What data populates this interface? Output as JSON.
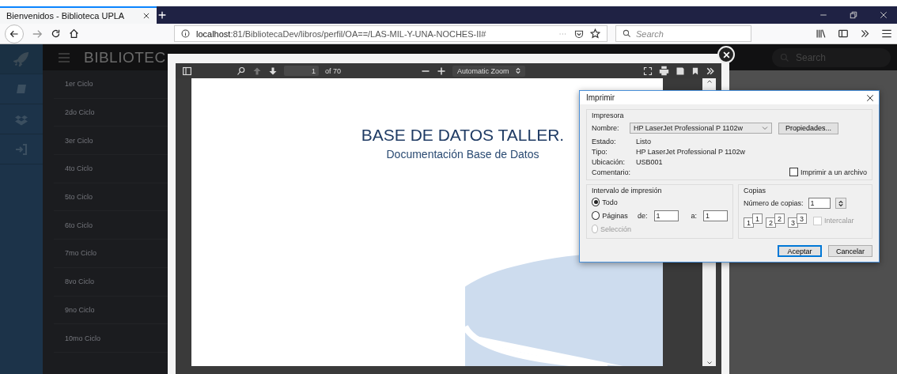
{
  "browser": {
    "tab": {
      "title": "Bienvenidos - Biblioteca UPLA",
      "selected": true
    },
    "url_host": "localhost",
    "url_rest": ":81/BibliotecaDev/libros/perfil/OA==/LAS-MIL-Y-UNA-NOCHES-II#",
    "search": {
      "placeholder": "Search"
    }
  },
  "app": {
    "brand": "BIBLIOTEC",
    "search": {
      "placeholder": "Search"
    },
    "sidebar": [
      {
        "label": "1er Ciclo"
      },
      {
        "label": "2do Ciclo"
      },
      {
        "label": "3er Ciclo"
      },
      {
        "label": "4to Ciclo"
      },
      {
        "label": "5to Ciclo"
      },
      {
        "label": "6to Ciclo"
      },
      {
        "label": "7mo Ciclo"
      },
      {
        "label": "8vo Ciclo"
      },
      {
        "label": "9no Ciclo"
      },
      {
        "label": "10mo Ciclo"
      }
    ]
  },
  "pdf_viewer": {
    "page": "1",
    "page_count": "of 70",
    "zoom": "Automatic Zoom",
    "title": "BASE DE DATOS TALLER.",
    "subtitle": "Documentación Base de Datos"
  },
  "print_dialog": {
    "title": "Imprimir",
    "printer_group": "Impresora",
    "name_label": "Nombre:",
    "name_value": "HP LaserJet Professional P 1102w",
    "properties_button": "Propiedades...",
    "info": [
      {
        "label": "Estado:",
        "value": "Listo"
      },
      {
        "label": "Tipo:",
        "value": "HP LaserJet Professional P 1102w"
      },
      {
        "label": "Ubicación:",
        "value": "USB001"
      },
      {
        "label": "Comentario:"
      }
    ],
    "print_to_file": {
      "label": "Imprimir a un archivo",
      "checked": false
    },
    "range_group": "Intervalo de impresión",
    "ranges": [
      {
        "label": "Todo",
        "selected": true,
        "disabled": false
      },
      {
        "label": "Páginas",
        "selected": false,
        "disabled": false
      },
      {
        "label": "Selección",
        "selected": false,
        "disabled": true
      }
    ],
    "from_label": "de:",
    "from_value": "1",
    "to_label": "a:",
    "to_value": "1",
    "copies_group": "Copias",
    "copies_label": "Número de copias:",
    "copies_value": "1",
    "collate_pages": [
      {
        "front": "1",
        "back": "1"
      },
      {
        "front": "2",
        "back": "2"
      },
      {
        "front": "3",
        "back": "3"
      }
    ],
    "collate": {
      "label": "Intercalar",
      "checked": false,
      "disabled": true
    },
    "buttons": [
      {
        "label": "Aceptar",
        "default": true
      },
      {
        "label": "Cancelar",
        "default": false
      }
    ]
  }
}
